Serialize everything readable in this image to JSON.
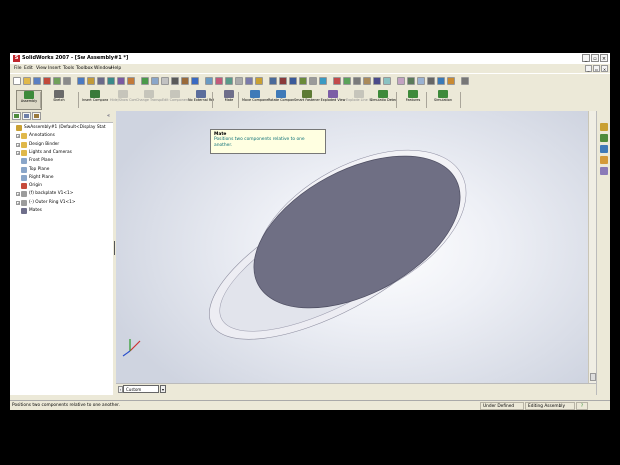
{
  "window": {
    "title": "SolidWorks 2007 - [Sw Assembly#1 *]"
  },
  "menu": [
    "File",
    "Edit",
    "View",
    "Insert",
    "Tools",
    "Toolbox",
    "Window",
    "Help"
  ],
  "command_manager": [
    {
      "label": "Assembly",
      "state": "active",
      "color": "#3d8a3a"
    },
    {
      "label": "Sketch",
      "state": "normal",
      "color": "#6a6a6a"
    },
    {
      "label": "Insert Compone...",
      "state": "normal",
      "color": "#3a7a3a"
    },
    {
      "label": "Hide/Show Componen...",
      "state": "disabled",
      "color": "#9a9a9a"
    },
    {
      "label": "Change Transparen...",
      "state": "disabled",
      "color": "#9a9a9a"
    },
    {
      "label": "Edit Component",
      "state": "disabled",
      "color": "#9a9a9a"
    },
    {
      "label": "No External References",
      "state": "normal",
      "color": "#5b6d9c"
    },
    {
      "label": "Mate",
      "state": "normal",
      "color": "#6e6e8a"
    },
    {
      "label": "Move Component",
      "state": "normal",
      "color": "#3f7ab8"
    },
    {
      "label": "Rotate Component",
      "state": "normal",
      "color": "#3f7ab8"
    },
    {
      "label": "Smart Fasteners",
      "state": "normal",
      "color": "#5d7a34"
    },
    {
      "label": "Exploded View",
      "state": "normal",
      "color": "#7c5ea6"
    },
    {
      "label": "Explode Line Sketch",
      "state": "disabled",
      "color": "#9a9a9a"
    },
    {
      "label": "Simulatio Detection",
      "state": "normal",
      "color": "#3d8a3a"
    },
    {
      "label": "Features",
      "state": "normal",
      "color": "#3d8a3a"
    },
    {
      "label": "Simulation",
      "state": "normal",
      "color": "#3d8a3a"
    }
  ],
  "tooltip": {
    "title": "Mate",
    "body": "Positions two components relative to one another."
  },
  "tree": [
    {
      "label": "SwAssembly#1  (Default<Display Stat",
      "icon": "assembly-icon",
      "color": "#c9a032",
      "indent": 0,
      "expander": ""
    },
    {
      "label": "Annotations",
      "icon": "annotations-folder-icon",
      "color": "#e0b84a",
      "indent": 1,
      "expander": "+"
    },
    {
      "label": "Design Binder",
      "icon": "design-binder-icon",
      "color": "#e0b84a",
      "indent": 1,
      "expander": "+"
    },
    {
      "label": "Lights and Cameras",
      "icon": "lights-folder-icon",
      "color": "#e0b84a",
      "indent": 1,
      "expander": "+"
    },
    {
      "label": "Front Plane",
      "icon": "plane-icon",
      "color": "#8aa6c9",
      "indent": 1,
      "expander": ""
    },
    {
      "label": "Top Plane",
      "icon": "plane-icon",
      "color": "#8aa6c9",
      "indent": 1,
      "expander": ""
    },
    {
      "label": "Right Plane",
      "icon": "plane-icon",
      "color": "#8aa6c9",
      "indent": 1,
      "expander": ""
    },
    {
      "label": "Origin",
      "icon": "origin-icon",
      "color": "#c74b3c",
      "indent": 1,
      "expander": ""
    },
    {
      "label": "(f) backplate V1<1>",
      "icon": "part-icon",
      "color": "#9c9c9c",
      "indent": 1,
      "expander": "+"
    },
    {
      "label": "(-) Outer Ring V1<1>",
      "icon": "part-icon",
      "color": "#9c9c9c",
      "indent": 1,
      "expander": "+"
    },
    {
      "label": "Mates",
      "icon": "mates-icon",
      "color": "#6e6e8a",
      "indent": 1,
      "expander": ""
    }
  ],
  "viewport": {
    "plate_color": "#6f6f84",
    "ring_color": "#ededf3",
    "bg_center": "#ffffff",
    "bg_edge": "#cfd4e0"
  },
  "hscroll": {
    "custom_tab": "Custom"
  },
  "status": {
    "message": "Positions two components relative to one another.",
    "definition": "Under Defined",
    "mode": "Editing Assembly",
    "help": "?"
  }
}
